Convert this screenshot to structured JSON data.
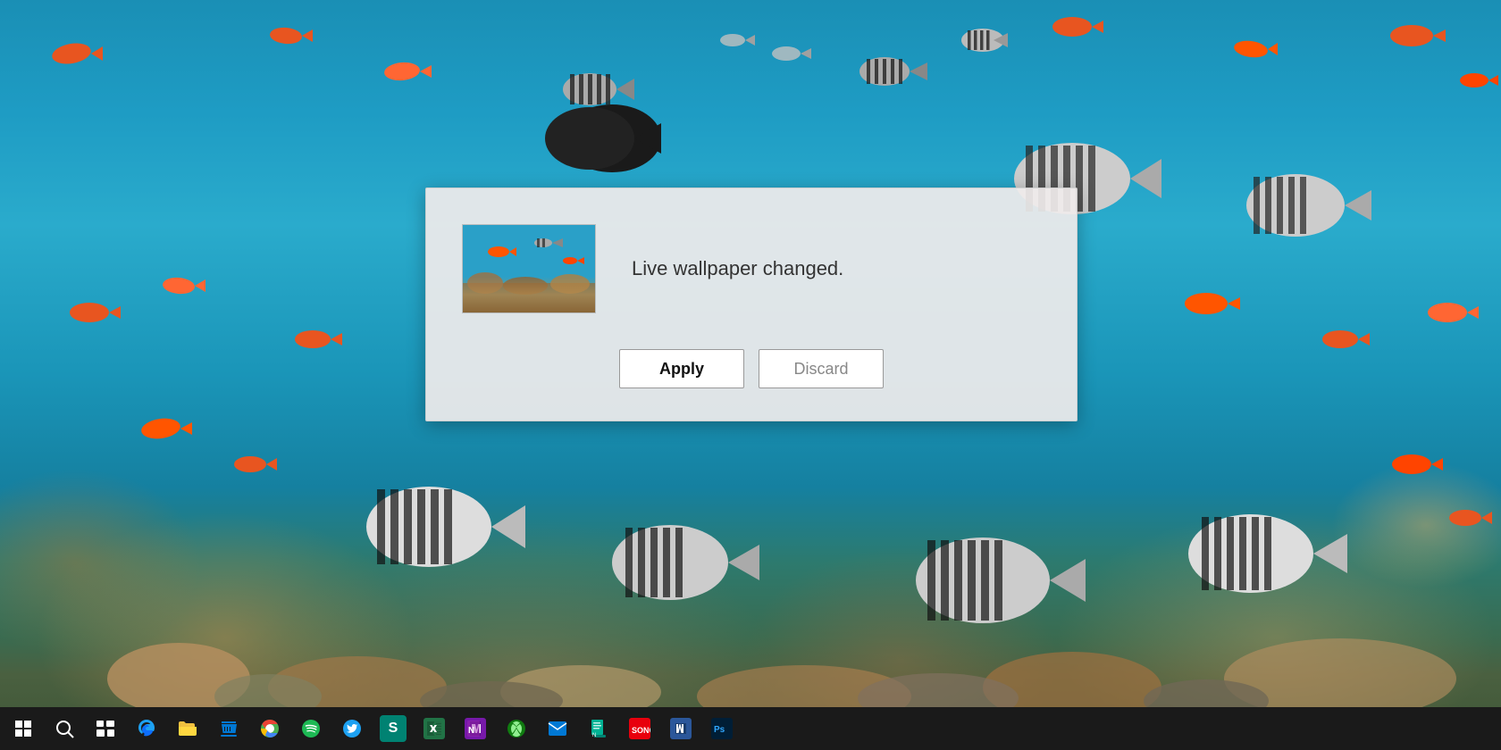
{
  "desktop": {
    "background_description": "Underwater coral reef with colorful fish"
  },
  "dialog": {
    "thumbnail_alt": "Underwater wallpaper preview",
    "message": "Live wallpaper changed.",
    "apply_label": "Apply",
    "discard_label": "Discard"
  },
  "taskbar": {
    "icons": [
      {
        "name": "start-button",
        "label": "Start",
        "color": "#ffffff"
      },
      {
        "name": "search-button",
        "label": "Search",
        "color": "#ffffff"
      },
      {
        "name": "task-view-button",
        "label": "Task View",
        "color": "#ffffff"
      },
      {
        "name": "edge-button",
        "label": "Microsoft Edge",
        "color": "#1da1f2"
      },
      {
        "name": "file-explorer-button",
        "label": "File Explorer",
        "color": "#f0c040"
      },
      {
        "name": "store-button",
        "label": "Microsoft Store",
        "color": "#0078d4"
      },
      {
        "name": "chrome-button",
        "label": "Google Chrome",
        "color": "#4caf50"
      },
      {
        "name": "spotify-button",
        "label": "Spotify",
        "color": "#1db954"
      },
      {
        "name": "twitter-button",
        "label": "Twitter",
        "color": "#1da1f2"
      },
      {
        "name": "sway-button",
        "label": "Sway",
        "color": "#008272"
      },
      {
        "name": "excel-button",
        "label": "Excel",
        "color": "#217346"
      },
      {
        "name": "onenote-button",
        "label": "OneNote",
        "color": "#7719aa"
      },
      {
        "name": "xbox-button",
        "label": "Xbox",
        "color": "#107c10"
      },
      {
        "name": "mail-button",
        "label": "Mail",
        "color": "#0078d4"
      },
      {
        "name": "note-button",
        "label": "Notepad",
        "color": "#00b294"
      },
      {
        "name": "sonos-button",
        "label": "Sonos",
        "color": "#e8000d"
      },
      {
        "name": "word-button",
        "label": "Word",
        "color": "#2b579a"
      },
      {
        "name": "photoshop-button",
        "label": "Photoshop",
        "color": "#001e36"
      }
    ]
  }
}
